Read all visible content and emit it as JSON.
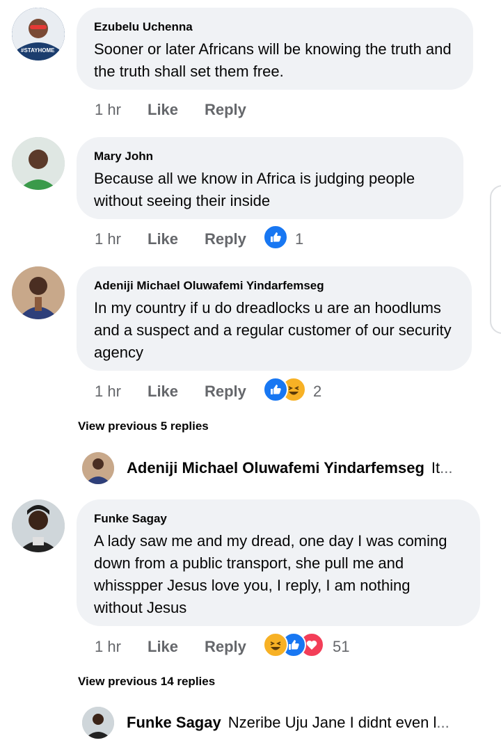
{
  "comments": [
    {
      "author": "Ezubelu Uchenna",
      "text": "Sooner or later Africans will be knowing the truth and the truth shall set them free.",
      "time": "1 hr",
      "like": "Like",
      "reply": "Reply",
      "reactions": [],
      "reaction_count": "",
      "avatar_badge": "#STAYHOME"
    },
    {
      "author": "Mary John",
      "text": "Because all we know in Africa is judging people without seeing their inside",
      "time": "1 hr",
      "like": "Like",
      "reply": "Reply",
      "reactions": [
        "like"
      ],
      "reaction_count": "1"
    },
    {
      "author": "Adeniji Michael Oluwafemi Yindarfemseg",
      "text": "In my country if u do dreadlocks u are an hoodlums and a suspect and a regular customer of our security agency",
      "time": "1 hr",
      "like": "Like",
      "reply": "Reply",
      "reactions": [
        "like",
        "haha"
      ],
      "reaction_count": "2"
    },
    {
      "author": "Funke Sagay",
      "text": "A lady saw me and my dread, one day I was coming down from a public transport, she pull me and whisspper Jesus love you, I reply, I am nothing without Jesus",
      "time": "1 hr",
      "like": "Like",
      "reply": "Reply",
      "reactions": [
        "haha",
        "like",
        "love"
      ],
      "reaction_count": "51"
    }
  ],
  "view_previous": [
    "View previous 5 replies",
    "View previous 14 replies"
  ],
  "reply_previews": [
    {
      "author": "Adeniji Michael Oluwafemi Yindarfemseg",
      "snippet": "It",
      "ellipsis": "..."
    },
    {
      "author": "Funke Sagay",
      "snippet": "Nzeribe Uju Jane I didnt even l",
      "ellipsis": "..."
    }
  ],
  "colors": {
    "bubble": "#f0f2f5",
    "meta_text": "#65676b",
    "like_blue": "#1877f2",
    "love_red": "#f33e58",
    "haha_yellow": "#f7b125"
  }
}
